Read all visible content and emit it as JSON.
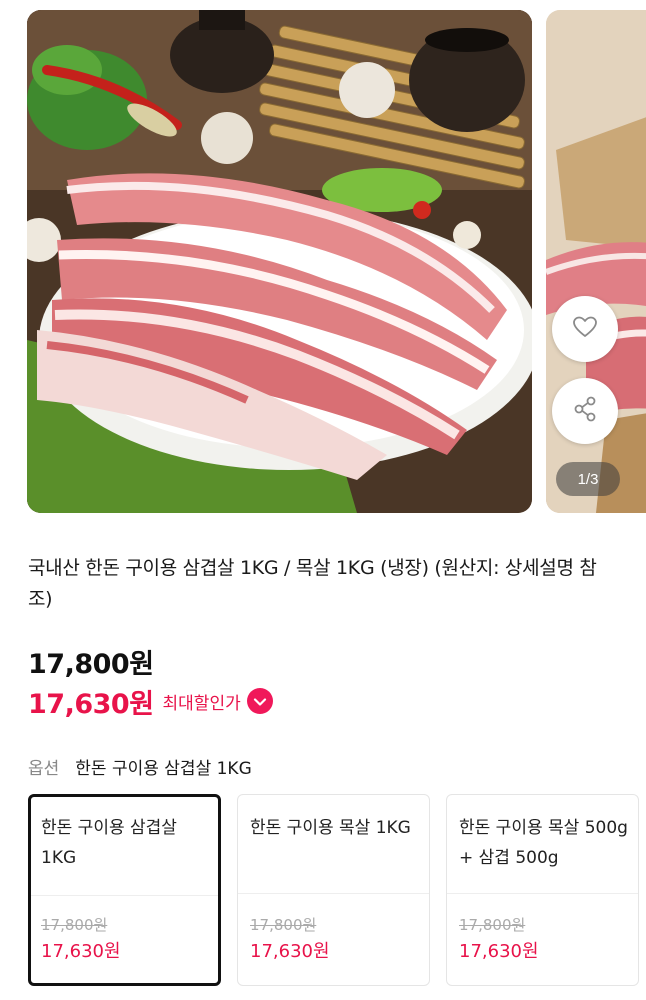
{
  "gallery": {
    "main_image": "pork-belly-platter-photo",
    "next_image": "pork-slices-photo",
    "pager": "1/3",
    "like_icon": "heart-icon",
    "share_icon": "share-icon"
  },
  "product": {
    "title": "국내산 한돈 구이용 삼겹살 1KG / 목살 1KG (냉장) (원산지: 상세설명 참조)",
    "price_original": "17,800원",
    "price_sale": "17,630원",
    "discount_label": "최대할인가",
    "discount_toggle_icon": "chevron-down-icon"
  },
  "option": {
    "label": "옵션",
    "selected_value": "한돈 구이용 삼겹살 1KG",
    "cards": [
      {
        "name": "한돈 구이용 삼겹살 1KG",
        "old_price": "17,800원",
        "new_price": "17,630원",
        "selected": true
      },
      {
        "name": "한돈 구이용 목살 1KG",
        "old_price": "17,800원",
        "new_price": "17,630원",
        "selected": false
      },
      {
        "name": "한돈 구이용 목살 500g + 삼겹 500g",
        "old_price": "17,800원",
        "new_price": "17,630원",
        "selected": false
      }
    ]
  },
  "colors": {
    "accent": "#e8134a",
    "toggle": "#f0185a",
    "selected_border": "#111111"
  }
}
